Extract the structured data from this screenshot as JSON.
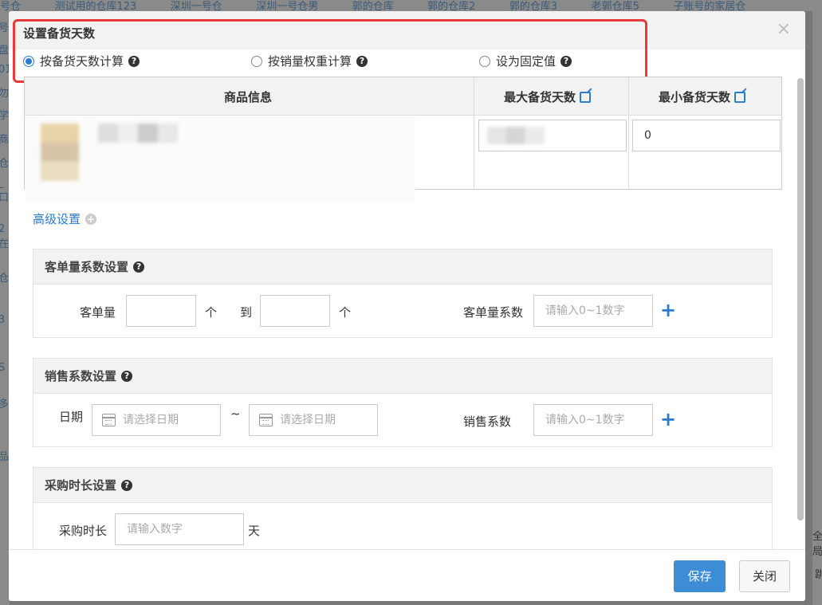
{
  "background": {
    "tabs": [
      "号仓",
      "测试用的仓库123",
      "深圳一号仓",
      "深圳一号仓男",
      "郭的仓库",
      "郭的仓库2",
      "郭的仓库3",
      "老郭仓库5",
      "子账号的家居仓"
    ],
    "left_chars": [
      "号",
      "盘",
      "01",
      "勿",
      "学",
      "商",
      "仓",
      "_口",
      "2在",
      "仓",
      "3",
      "S",
      "多",
      "品"
    ],
    "right_chars": [
      "全局",
      "跳"
    ]
  },
  "modal": {
    "title": "设置备货天数",
    "close_symbol": "×",
    "modes": [
      {
        "label": "按备货天数计算",
        "checked": true
      },
      {
        "label": "按销量权重计算",
        "checked": false
      },
      {
        "label": "设为固定值",
        "checked": false
      }
    ],
    "help_symbol": "?",
    "table": {
      "col_product": "商品信息",
      "col_max": "最大备货天数",
      "col_min": "最小备货天数",
      "min_value": "0"
    },
    "advanced": {
      "label": "高级设置",
      "icon_symbol": "+"
    },
    "order_qty_panel": {
      "title": "客单量系数设置",
      "qty_label": "客单量",
      "unit": "个",
      "to_label": "到",
      "coef_label": "客单量系数",
      "coef_placeholder": "请输入0~1数字"
    },
    "sales_panel": {
      "title": "销售系数设置",
      "date_label": "日期",
      "date_placeholder": "请选择日期",
      "range_sep": "~",
      "coef_label": "销售系数",
      "coef_placeholder": "请输入0~1数字"
    },
    "purchase_panel": {
      "title": "采购时长设置",
      "label": "采购时长",
      "placeholder": "请输入数字",
      "unit": "天"
    },
    "add_symbol": "+",
    "footer": {
      "save": "保存",
      "close": "关闭"
    },
    "accent_color": "#2b7bd1",
    "highlight_color": "#e83a3a"
  }
}
